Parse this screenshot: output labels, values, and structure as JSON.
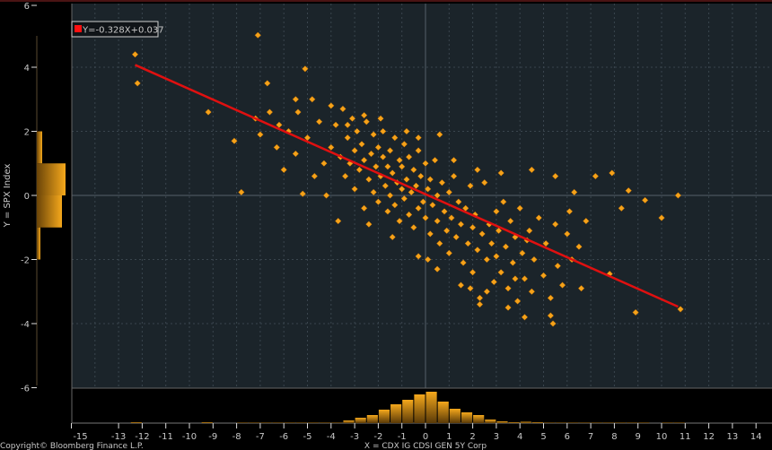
{
  "chart_data": {
    "type": "scatter",
    "title": "",
    "xlabel": "X = CDX IG CDSI GEN 5Y Corp",
    "ylabel": "Y = SPX Index",
    "xlim": [
      -15,
      14.7
    ],
    "ylim": [
      -6,
      6
    ],
    "xticks": [
      -15,
      -13,
      -12,
      -11,
      -10,
      -9,
      -8,
      -7,
      -6,
      -5,
      -4,
      -3,
      -2,
      -1,
      0,
      1,
      2,
      3,
      4,
      5,
      6,
      7,
      8,
      9,
      10,
      11,
      12,
      13,
      14
    ],
    "yticks": [
      6,
      4,
      2,
      0,
      -2,
      -4,
      -6
    ],
    "grid": true,
    "regression": {
      "label": "Y=-0.328X+0.037",
      "slope": -0.328,
      "intercept": 0.037,
      "x_range": [
        -12.3,
        10.7
      ],
      "color": "#e01010"
    },
    "point_color": "#f5a21a",
    "points": [
      [
        -12.3,
        4.4
      ],
      [
        -12.2,
        3.5
      ],
      [
        -7.1,
        5.0
      ],
      [
        -9.2,
        2.6
      ],
      [
        -8.1,
        1.7
      ],
      [
        -7.8,
        0.1
      ],
      [
        -5.1,
        3.95
      ],
      [
        -6.7,
        3.5
      ],
      [
        -6.2,
        2.2
      ],
      [
        -5.5,
        3.0
      ],
      [
        10.7,
        0.0
      ],
      [
        10.0,
        -0.7
      ],
      [
        10.8,
        -3.55
      ],
      [
        8.9,
        -3.65
      ],
      [
        9.3,
        -0.15
      ],
      [
        8.6,
        0.15
      ],
      [
        8.3,
        -0.4
      ],
      [
        7.9,
        0.7
      ],
      [
        7.2,
        0.6
      ],
      [
        7.8,
        -2.45
      ],
      [
        6.6,
        -2.9
      ],
      [
        5.3,
        -3.75
      ],
      [
        5.4,
        -4.0
      ],
      [
        2.3,
        -3.4
      ],
      [
        0.1,
        -2.0
      ],
      [
        -4,
        1.5
      ],
      [
        -3.8,
        2.2
      ],
      [
        -3.6,
        1.2
      ],
      [
        -3.5,
        2.7
      ],
      [
        -3.4,
        0.6
      ],
      [
        -3.3,
        1.8
      ],
      [
        -3.2,
        1.0
      ],
      [
        -3.1,
        2.4
      ],
      [
        -3,
        0.2
      ],
      [
        -3,
        1.4
      ],
      [
        -2.9,
        2.0
      ],
      [
        -2.8,
        0.8
      ],
      [
        -2.7,
        1.6
      ],
      [
        -2.6,
        -0.4
      ],
      [
        -2.6,
        1.1
      ],
      [
        -2.5,
        2.3
      ],
      [
        -2.4,
        0.5
      ],
      [
        -2.3,
        1.3
      ],
      [
        -2.2,
        1.9
      ],
      [
        -2.2,
        0.1
      ],
      [
        -2.1,
        0.9
      ],
      [
        -2,
        1.5
      ],
      [
        -2,
        -0.2
      ],
      [
        -1.9,
        0.6
      ],
      [
        -1.8,
        1.2
      ],
      [
        -1.8,
        2.0
      ],
      [
        -1.7,
        0.3
      ],
      [
        -1.6,
        0.9
      ],
      [
        -1.6,
        -0.5
      ],
      [
        -1.5,
        1.4
      ],
      [
        -1.5,
        0.0
      ],
      [
        -1.4,
        0.7
      ],
      [
        -1.3,
        1.8
      ],
      [
        -1.3,
        -0.3
      ],
      [
        -1.2,
        0.4
      ],
      [
        -1.1,
        1.1
      ],
      [
        -1.1,
        -0.8
      ],
      [
        -1,
        0.2
      ],
      [
        -1,
        0.9
      ],
      [
        -0.9,
        1.6
      ],
      [
        -0.9,
        -0.1
      ],
      [
        -0.8,
        0.5
      ],
      [
        -0.7,
        -0.6
      ],
      [
        -0.7,
        1.2
      ],
      [
        -0.6,
        0.1
      ],
      [
        -0.5,
        0.8
      ],
      [
        -0.5,
        -1.0
      ],
      [
        -0.4,
        0.3
      ],
      [
        -0.3,
        1.4
      ],
      [
        -0.3,
        -0.4
      ],
      [
        -0.2,
        0.6
      ],
      [
        -0.1,
        -0.2
      ],
      [
        0,
        1.0
      ],
      [
        0,
        -0.7
      ],
      [
        0.1,
        0.2
      ],
      [
        0.2,
        -1.2
      ],
      [
        0.2,
        0.5
      ],
      [
        0.3,
        -0.3
      ],
      [
        0.4,
        1.1
      ],
      [
        0.5,
        -0.8
      ],
      [
        0.5,
        0.0
      ],
      [
        0.6,
        -1.5
      ],
      [
        0.7,
        0.4
      ],
      [
        0.8,
        -0.5
      ],
      [
        0.9,
        -1.1
      ],
      [
        1,
        0.1
      ],
      [
        1,
        -1.8
      ],
      [
        1.1,
        -0.7
      ],
      [
        1.2,
        0.6
      ],
      [
        1.3,
        -1.3
      ],
      [
        1.4,
        -0.2
      ],
      [
        1.5,
        -0.9
      ],
      [
        1.6,
        -2.1
      ],
      [
        1.7,
        -0.4
      ],
      [
        1.8,
        -1.5
      ],
      [
        1.9,
        0.3
      ],
      [
        2,
        -1.0
      ],
      [
        2,
        -2.4
      ],
      [
        2.1,
        -0.6
      ],
      [
        2.2,
        -1.7
      ],
      [
        2.3,
        -3.2
      ],
      [
        2.4,
        -1.2
      ],
      [
        2.5,
        0.4
      ],
      [
        2.6,
        -2.0
      ],
      [
        2.7,
        -0.9
      ],
      [
        2.8,
        -1.5
      ],
      [
        2.9,
        -2.7
      ],
      [
        3,
        -0.5
      ],
      [
        3,
        -1.9
      ],
      [
        3.1,
        -1.1
      ],
      [
        3.2,
        -2.4
      ],
      [
        3.3,
        -0.2
      ],
      [
        3.4,
        -1.6
      ],
      [
        3.5,
        -2.9
      ],
      [
        3.6,
        -0.8
      ],
      [
        3.7,
        -2.1
      ],
      [
        3.8,
        -1.3
      ],
      [
        3.9,
        -3.3
      ],
      [
        4,
        -0.4
      ],
      [
        4.1,
        -1.8
      ],
      [
        4.2,
        -2.6
      ],
      [
        4.4,
        -1.1
      ],
      [
        4.5,
        -3.0
      ],
      [
        4.6,
        -2.0
      ],
      [
        4.8,
        -0.7
      ],
      [
        5,
        -2.5
      ],
      [
        5.1,
        -1.5
      ],
      [
        5.3,
        -3.2
      ],
      [
        5.5,
        -0.9
      ],
      [
        5.6,
        -2.2
      ],
      [
        5.8,
        -2.8
      ],
      [
        6,
        -1.2
      ],
      [
        6.2,
        -2.0
      ],
      [
        6.5,
        -1.6
      ],
      [
        6.8,
        -0.8
      ],
      [
        -4.3,
        1.0
      ],
      [
        -4.5,
        2.3
      ],
      [
        -4.7,
        0.6
      ],
      [
        -5,
        1.8
      ],
      [
        -5.2,
        0.05
      ],
      [
        -5.5,
        1.3
      ],
      [
        -5.8,
        2.0
      ],
      [
        -6,
        0.8
      ],
      [
        -6.3,
        1.5
      ],
      [
        -6.6,
        2.6
      ],
      [
        -7,
        1.9
      ],
      [
        -7.2,
        2.4
      ],
      [
        -4.2,
        0.0
      ],
      [
        -3.7,
        -0.8
      ],
      [
        -5.4,
        2.6
      ],
      [
        -4.8,
        3.0
      ],
      [
        -4.0,
        2.8
      ],
      [
        -3.3,
        2.2
      ],
      [
        -2.6,
        2.5
      ],
      [
        -1.9,
        2.4
      ],
      [
        -0.8,
        2.0
      ],
      [
        -0.3,
        1.8
      ],
      [
        0.6,
        1.9
      ],
      [
        1.2,
        1.1
      ],
      [
        2.2,
        0.8
      ],
      [
        3.2,
        0.7
      ],
      [
        4.5,
        0.8
      ],
      [
        5.5,
        0.6
      ],
      [
        6.1,
        -0.5
      ],
      [
        6.3,
        0.1
      ],
      [
        0.5,
        -2.3
      ],
      [
        1.5,
        -2.8
      ],
      [
        3.5,
        -3.5
      ],
      [
        4.2,
        -3.8
      ],
      [
        -1.4,
        -1.3
      ],
      [
        -2.4,
        -0.9
      ],
      [
        -0.3,
        -1.9
      ],
      [
        1.9,
        -2.9
      ],
      [
        3.8,
        -2.6
      ],
      [
        4.3,
        -1.4
      ],
      [
        2.6,
        -3.0
      ]
    ],
    "x_histogram": {
      "bin_width": 0.5,
      "bins": [
        [
          -12.5,
          1
        ],
        [
          -9.5,
          1
        ],
        [
          -8,
          0.5
        ],
        [
          -7.5,
          0.5
        ],
        [
          -7,
          0.5
        ],
        [
          -6.5,
          0.5
        ],
        [
          -6,
          0.5
        ],
        [
          -5.5,
          0.5
        ],
        [
          -5,
          0.5
        ],
        [
          -4.5,
          0.5
        ],
        [
          -4,
          0.5
        ],
        [
          -3.5,
          3
        ],
        [
          -3,
          6
        ],
        [
          -2.5,
          9
        ],
        [
          -2,
          15
        ],
        [
          -1.5,
          21
        ],
        [
          -1,
          26
        ],
        [
          -0.5,
          32
        ],
        [
          0,
          35
        ],
        [
          0.5,
          24
        ],
        [
          1,
          16
        ],
        [
          1.5,
          12
        ],
        [
          2,
          9
        ],
        [
          2.5,
          4
        ],
        [
          3,
          2
        ],
        [
          3.5,
          1
        ],
        [
          4,
          1.5
        ],
        [
          4.5,
          1
        ],
        [
          5,
          0.5
        ],
        [
          5.5,
          0.5
        ],
        [
          6,
          0.5
        ],
        [
          6.5,
          0.5
        ],
        [
          7,
          0.5
        ],
        [
          7.5,
          0.5
        ],
        [
          8,
          0.5
        ],
        [
          8.5,
          0.5
        ],
        [
          9,
          0.5
        ],
        [
          10,
          0.5
        ],
        [
          10.5,
          0.5
        ]
      ]
    },
    "y_histogram": {
      "bin_width": 1,
      "bins": [
        [
          1,
          6
        ],
        [
          0,
          32
        ],
        [
          -1,
          28
        ],
        [
          -2,
          4
        ]
      ]
    }
  },
  "legend_label": "Y=-0.328X+0.037",
  "footer": {
    "copyright": "Copyright© Bloomberg Finance L.P."
  }
}
